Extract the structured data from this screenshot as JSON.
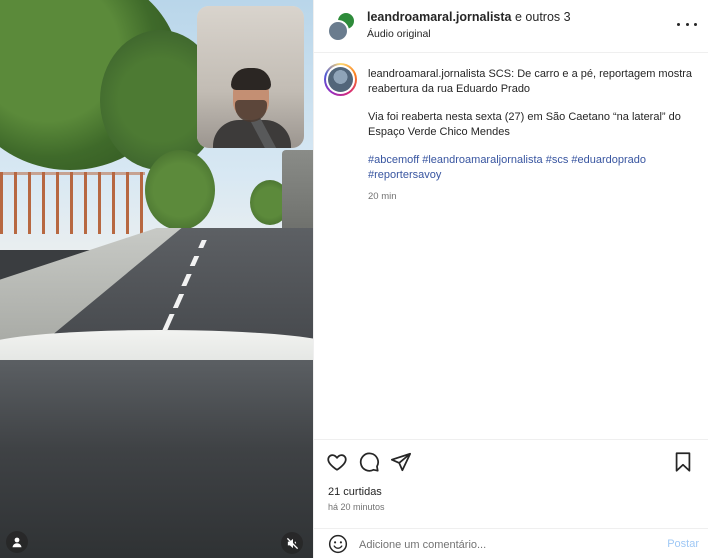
{
  "header": {
    "username": "leandroamaral.jornalista",
    "others_text": "e outros 3",
    "audio_label": "Áudio original"
  },
  "caption": {
    "username": "leandroamaral.jornalista",
    "headline": "SCS: De carro e a pé, reportagem mostra reabertura da rua Eduardo Prado",
    "body": "Via foi reaberta nesta sexta (27) em São Caetano “na lateral” do Espaço Verde Chico Mendes",
    "hashtags": "#abcemoff #leandroamaraljornalista #scs #eduardoprado #reportersavoy",
    "time": "20 min"
  },
  "actions": {
    "likes": "21 curtidas",
    "posted_ago": "há 20 minutos"
  },
  "comment_bar": {
    "placeholder": "Adicione um comentário...",
    "post_label": "Postar"
  },
  "icons": {
    "like": "heart-icon",
    "comment": "comment-icon",
    "share": "send-icon",
    "save": "bookmark-icon",
    "emoji": "emoji-icon",
    "mute": "speaker-muted-icon",
    "tagged": "user-icon",
    "more": "more-icon"
  },
  "colors": {
    "link": "#3855a0",
    "post_disabled": "#9fc8f5",
    "muted_text": "#737373"
  }
}
